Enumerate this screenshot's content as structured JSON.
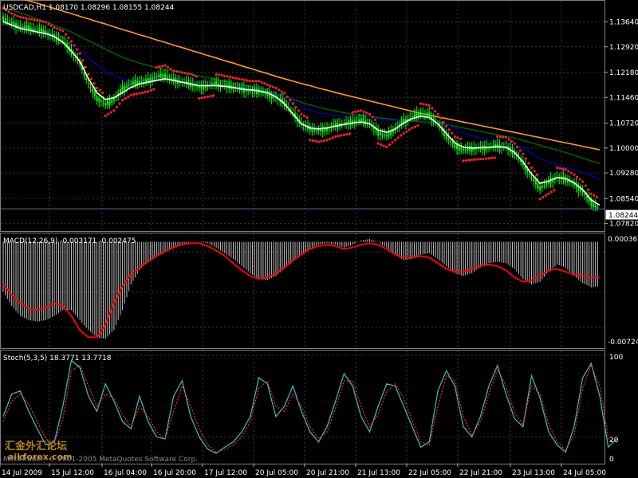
{
  "window": {
    "symbol_header": "USDCAD,H1  1.08170 1.08296 1.08155 1.08244",
    "current_price": "1.08244"
  },
  "watermark": {
    "forum_cn": "汇金外汇论坛",
    "forum_url": "aikforex.com",
    "copyright": "MetaTrader, © 2001-2005 MetaQuotes Software Corp."
  },
  "colors": {
    "background": "#000000",
    "candles": "#00ff00",
    "ma_fast": "#ffffff",
    "ma_blue": "#0000cc",
    "ma_green": "#006400",
    "ma_orange": "#ff9a1f",
    "sar": "#ff2020",
    "macd_hist": "#c0c0c0",
    "macd_signal": "#ff0000",
    "stoch_main": "#40c0c0",
    "stoch_signal": "#ff3030"
  },
  "chart_data": [
    {
      "type": "line",
      "title": "USDCAD,H1",
      "subtitle": "1.08170 1.08296 1.08155 1.08244",
      "y_ticks": [
        "1.13640",
        "1.12920",
        "1.12180",
        "1.11460",
        "1.10720",
        "1.10000",
        "1.09280",
        "1.08540",
        "1.07820"
      ],
      "ylim": [
        1.0765,
        1.1418
      ],
      "last_price": 1.08244,
      "series": [
        {
          "key": "price",
          "values": [
            1.1375,
            1.136,
            1.135,
            1.1345,
            1.134,
            1.1335,
            1.132,
            1.131,
            1.128,
            1.1245,
            1.1185,
            1.1145,
            1.1125,
            1.114,
            1.117,
            1.1185,
            1.119,
            1.1195,
            1.1205,
            1.121,
            1.1195,
            1.119,
            1.1185,
            1.1175,
            1.118,
            1.1185,
            1.118,
            1.1175,
            1.117,
            1.1165,
            1.1165,
            1.1155,
            1.1145,
            1.113,
            1.11,
            1.107,
            1.1055,
            1.105,
            1.1055,
            1.1065,
            1.107,
            1.1075,
            1.108,
            1.107,
            1.1045,
            1.1035,
            1.1055,
            1.1075,
            1.109,
            1.11,
            1.1095,
            1.107,
            1.1035,
            1.1005,
            1.0995,
            1.0998,
            1.1,
            1.1002,
            1.1005,
            1.1003,
            1.0985,
            1.0955,
            1.0915,
            1.0885,
            1.09,
            1.0915,
            1.091,
            1.0895,
            1.0875,
            1.084,
            1.0825
          ]
        },
        {
          "key": "ma_fast",
          "values": [
            1.1365,
            1.1355,
            1.1345,
            1.134,
            1.1335,
            1.133,
            1.1322,
            1.1305,
            1.128,
            1.125,
            1.12,
            1.116,
            1.114,
            1.1145,
            1.116,
            1.1175,
            1.1185,
            1.119,
            1.1195,
            1.12,
            1.1195,
            1.119,
            1.1185,
            1.118,
            1.118,
            1.118,
            1.1178,
            1.1175,
            1.117,
            1.1168,
            1.1165,
            1.116,
            1.1148,
            1.1128,
            1.1098,
            1.107,
            1.1058,
            1.1055,
            1.1058,
            1.1063,
            1.1068,
            1.1072,
            1.1075,
            1.107,
            1.1052,
            1.1045,
            1.1055,
            1.1072,
            1.1085,
            1.1092,
            1.1088,
            1.107,
            1.1042,
            1.1015,
            1.1002,
            1.1,
            1.1001,
            1.1002,
            1.1004,
            1.1002,
            1.0988,
            1.096,
            1.0925,
            1.0898,
            1.0905,
            1.0915,
            1.0912,
            1.09,
            1.088,
            1.085,
            1.0835
          ]
        },
        {
          "key": "ma_blue",
          "values": [
            1.136,
            1.1355,
            1.135,
            1.1345,
            1.134,
            1.1335,
            1.133,
            1.132,
            1.13,
            1.128,
            1.126,
            1.124,
            1.122,
            1.121,
            1.12,
            1.1195,
            1.1195,
            1.1195,
            1.1198,
            1.12,
            1.12,
            1.1198,
            1.1195,
            1.119,
            1.1188,
            1.1185,
            1.1182,
            1.118,
            1.1178,
            1.1175,
            1.117,
            1.1165,
            1.116,
            1.115,
            1.1135,
            1.112,
            1.111,
            1.1102,
            1.1098,
            1.1095,
            1.1093,
            1.1092,
            1.1091,
            1.109,
            1.1085,
            1.108,
            1.108,
            1.1082,
            1.1085,
            1.1087,
            1.1085,
            1.108,
            1.107,
            1.1058,
            1.1045,
            1.1035,
            1.1028,
            1.1022,
            1.1018,
            1.1015,
            1.101,
            1.1,
            1.0985,
            1.097,
            1.096,
            1.0952,
            1.0945,
            1.0938,
            1.093,
            1.092,
            1.091
          ]
        },
        {
          "key": "ma_green",
          "values": [
            1.1405,
            1.1398,
            1.139,
            1.1382,
            1.1373,
            1.1365,
            1.1355,
            1.1345,
            1.1335,
            1.1322,
            1.131,
            1.1298,
            1.1285,
            1.1273,
            1.1262,
            1.1253,
            1.1245,
            1.1238,
            1.1232,
            1.1227,
            1.1222,
            1.1218,
            1.1213,
            1.1208,
            1.1203,
            1.1198,
            1.1193,
            1.1188,
            1.1183,
            1.1178,
            1.1172,
            1.1165,
            1.1158,
            1.115,
            1.114,
            1.1132,
            1.1125,
            1.1118,
            1.1112,
            1.1107,
            1.1102,
            1.1098,
            1.1095,
            1.1092,
            1.1088,
            1.1085,
            1.1082,
            1.108,
            1.1078,
            1.1076,
            1.1074,
            1.1072,
            1.1068,
            1.1063,
            1.1058,
            1.1053,
            1.1048,
            1.1043,
            1.1038,
            1.1033,
            1.1028,
            1.1022,
            1.1015,
            1.1008,
            1.1001,
            1.0994,
            1.0987,
            1.0979,
            1.0971,
            1.0963,
            1.0955
          ]
        },
        {
          "key": "ma_orange",
          "values": [
            1.145,
            1.144,
            1.1432,
            1.1425,
            1.1418,
            1.141,
            1.1403,
            1.1395,
            1.1388,
            1.138,
            1.1373,
            1.1365,
            1.1358,
            1.135,
            1.1342,
            1.1335,
            1.1327,
            1.132,
            1.1312,
            1.1305,
            1.1297,
            1.129,
            1.1282,
            1.1275,
            1.1267,
            1.126,
            1.1252,
            1.1245,
            1.1237,
            1.123,
            1.1222,
            1.1215,
            1.1207,
            1.12,
            1.1193,
            1.1186,
            1.118,
            1.1173,
            1.1167,
            1.116,
            1.1154,
            1.1148,
            1.1142,
            1.1136,
            1.113,
            1.1124,
            1.1118,
            1.1112,
            1.1106,
            1.11,
            1.1095,
            1.109,
            1.1085,
            1.108,
            1.1075,
            1.107,
            1.1065,
            1.106,
            1.1055,
            1.105,
            1.1045,
            1.104,
            1.1035,
            1.103,
            1.1025,
            1.102,
            1.1015,
            1.101,
            1.1005,
            1.1,
            1.0995
          ]
        }
      ]
    },
    {
      "type": "area",
      "title": "MACD(12,26,9) -0.003171 -0.002475",
      "y_ticks": [
        "0.000365",
        "-0.00724"
      ],
      "ylim": [
        -0.00724,
        0.000365
      ],
      "series": [
        {
          "key": "macd_hist",
          "values": [
            -0.0035,
            -0.0045,
            -0.0052,
            -0.0055,
            -0.0056,
            -0.0055,
            -0.0052,
            -0.0048,
            -0.0048,
            -0.0055,
            -0.0062,
            -0.0067,
            -0.0068,
            -0.0062,
            -0.0048,
            -0.003,
            -0.002,
            -0.0014,
            -0.001,
            -0.0007,
            -0.0004,
            -0.0002,
            0.0,
            0.0,
            -0.0001,
            -0.0004,
            -0.0008,
            -0.0012,
            -0.0017,
            -0.0022,
            -0.0026,
            -0.0027,
            -0.0024,
            -0.0019,
            -0.0014,
            -0.0009,
            -0.0005,
            -0.0002,
            -0.0001,
            -0.0002,
            -0.0004,
            -0.0002,
            0.0001,
            0.0002,
            0.0,
            -0.0004,
            -0.0009,
            -0.0013,
            -0.0012,
            -0.0009,
            -0.0008,
            -0.0012,
            -0.0017,
            -0.0022,
            -0.0024,
            -0.0022,
            -0.0018,
            -0.0015,
            -0.0014,
            -0.0015,
            -0.0019,
            -0.0026,
            -0.003,
            -0.0028,
            -0.0021,
            -0.0016,
            -0.0018,
            -0.0024,
            -0.0029,
            -0.0032,
            -0.0031
          ]
        },
        {
          "key": "macd_signal",
          "values": [
            -0.003,
            -0.0037,
            -0.0043,
            -0.0047,
            -0.0048,
            -0.0046,
            -0.0043,
            -0.0045,
            -0.0052,
            -0.0062,
            -0.0067,
            -0.0067,
            -0.0058,
            -0.0043,
            -0.0031,
            -0.0023,
            -0.0018,
            -0.0014,
            -0.001,
            -0.0007,
            -0.0004,
            -0.0002,
            -0.0001,
            -0.0001,
            -0.0003,
            -0.0006,
            -0.001,
            -0.0015,
            -0.002,
            -0.0024,
            -0.0026,
            -0.0025,
            -0.0022,
            -0.0018,
            -0.0013,
            -0.0009,
            -0.0005,
            -0.0003,
            -0.0002,
            -0.0003,
            -0.0005,
            -0.0004,
            -0.0002,
            -0.0001,
            -0.0002,
            -0.0005,
            -0.0009,
            -0.0011,
            -0.0011,
            -0.001,
            -0.0011,
            -0.0015,
            -0.0019,
            -0.0021,
            -0.0021,
            -0.0019,
            -0.0017,
            -0.0016,
            -0.0017,
            -0.002,
            -0.0025,
            -0.0028,
            -0.0027,
            -0.0024,
            -0.002,
            -0.0019,
            -0.0021,
            -0.0023,
            -0.0024,
            -0.0025,
            -0.0025
          ]
        }
      ]
    },
    {
      "type": "line",
      "title": "Stoch(5,3,5) 18.3771 13.7718",
      "y_ticks": [
        "100",
        "20",
        "0"
      ],
      "ylim": [
        0,
        100
      ],
      "series": [
        {
          "key": "stoch_main",
          "values": [
            40,
            62,
            65,
            45,
            28,
            12,
            15,
            50,
            95,
            88,
            60,
            45,
            72,
            55,
            35,
            28,
            60,
            35,
            20,
            18,
            60,
            75,
            40,
            20,
            8,
            4,
            10,
            15,
            25,
            40,
            78,
            72,
            40,
            50,
            70,
            45,
            25,
            15,
            30,
            55,
            82,
            70,
            40,
            25,
            50,
            72,
            70,
            50,
            30,
            10,
            15,
            65,
            85,
            70,
            30,
            20,
            40,
            70,
            90,
            62,
            38,
            30,
            80,
            58,
            25,
            12,
            5,
            30,
            78,
            92,
            60,
            10,
            18
          ]
        },
        {
          "key": "stoch_signal",
          "values": [
            35,
            55,
            62,
            52,
            35,
            18,
            14,
            38,
            85,
            90,
            70,
            50,
            62,
            58,
            42,
            30,
            50,
            40,
            25,
            18,
            45,
            70,
            50,
            28,
            12,
            5,
            8,
            12,
            20,
            35,
            68,
            75,
            50,
            45,
            62,
            50,
            30,
            18,
            25,
            48,
            75,
            75,
            50,
            30,
            42,
            65,
            72,
            58,
            36,
            15,
            12,
            50,
            80,
            75,
            40,
            22,
            35,
            62,
            86,
            70,
            44,
            32,
            70,
            62,
            32,
            15,
            7,
            22,
            68,
            90,
            70,
            18,
            14
          ]
        }
      ]
    }
  ],
  "time_axis": {
    "labels": [
      "14 Jul 2009",
      "15 Jul 12:00",
      "16 Jul 04:00",
      "16 Jul 20:00",
      "17 Jul 12:00",
      "20 Jul 05:00",
      "20 Jul 21:00",
      "21 Jul 13:00",
      "22 Jul 05:00",
      "22 Jul 21:00",
      "23 Jul 13:00",
      "24 Jul 05:00"
    ]
  }
}
